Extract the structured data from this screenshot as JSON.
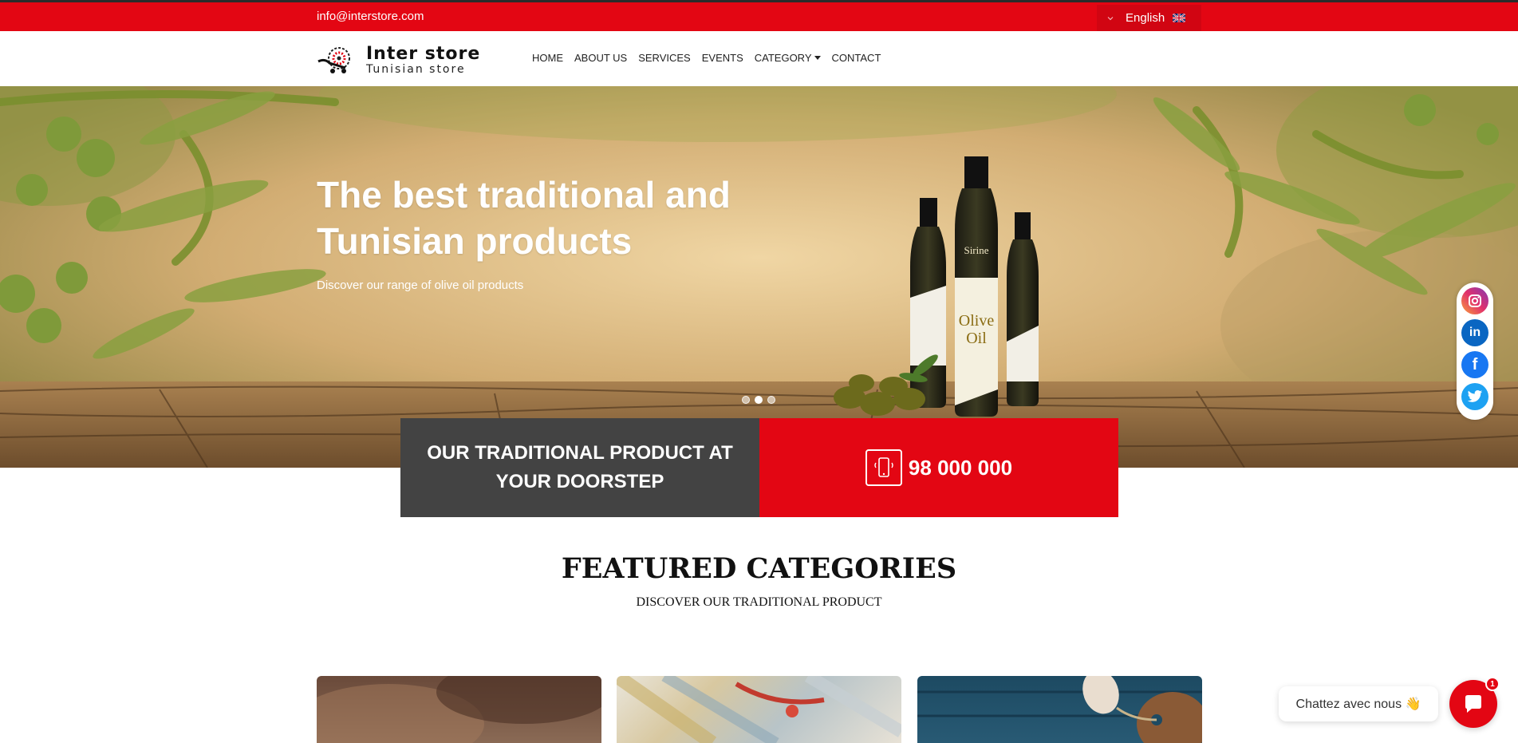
{
  "topbar": {
    "email": "info@interstore.com",
    "language": "English",
    "language_flag_icon": "uk-flag-icon",
    "chevron_icon": "chevron-down-icon"
  },
  "header": {
    "logo_title": "Inter store",
    "logo_subtitle": "Tunisian store",
    "nav": [
      "HOME",
      "ABOUT US",
      "SERVICES",
      "EVENTS",
      "CATEGORY",
      "CONTACT"
    ]
  },
  "hero": {
    "title_line1": "The best traditional and",
    "title_line2": "Tunisian products",
    "subtitle": "Discover our range of olive oil products",
    "slides": 3,
    "active_slide": 2
  },
  "cta": {
    "left_line1": "OUR TRADITIONAL PRODUCT AT",
    "left_line2": "YOUR DOORSTEP",
    "phone_icon": "mobile-phone-icon",
    "phone": "98 000 000"
  },
  "social": [
    {
      "name": "instagram-icon",
      "color": "#c13584"
    },
    {
      "name": "linkedin-icon",
      "color": "#0a66c2"
    },
    {
      "name": "facebook-icon",
      "color": "#1877f2"
    },
    {
      "name": "twitter-icon",
      "color": "#1da1f2"
    }
  ],
  "featured": {
    "title": "FEATURED CATEGORIES",
    "subtitle": "DISCOVER OUR TRADITIONAL PRODUCT"
  },
  "chat": {
    "label": "Chattez avec nous 👋",
    "badge": "1"
  },
  "colors": {
    "brand_red": "#e30613",
    "dark_gray": "#434343"
  }
}
